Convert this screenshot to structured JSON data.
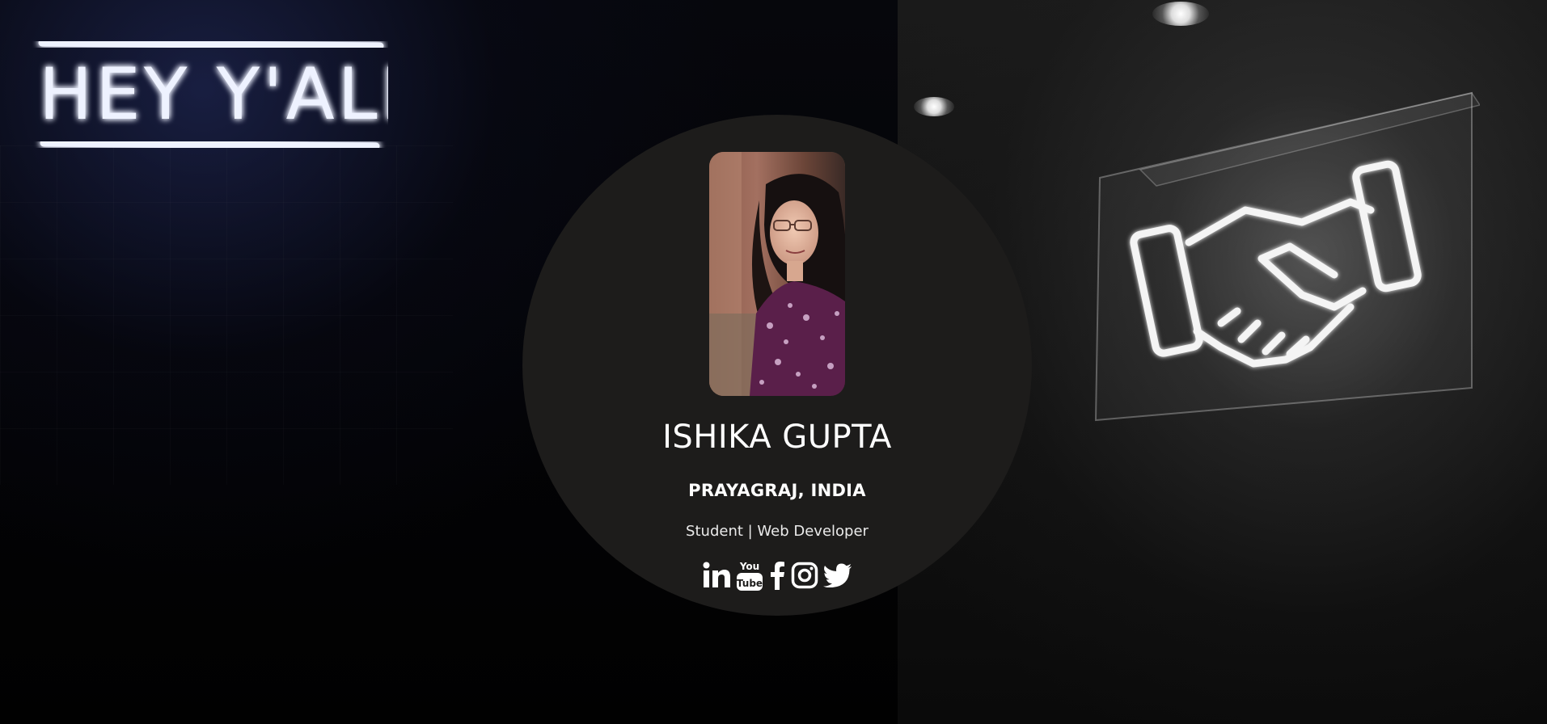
{
  "profile": {
    "name": "ISHIKA GUPTA",
    "location": "PRAYAGRAJ, INDIA",
    "tagline": "Student | Web Developer",
    "photo_alt": "Ishika Gupta"
  },
  "background": {
    "neon_sign_text": "HEY Y'ALL"
  },
  "social": [
    {
      "icon": "linkedin-icon",
      "label": "LinkedIn"
    },
    {
      "icon": "youtube-icon",
      "label": "YouTube"
    },
    {
      "icon": "facebook-icon",
      "label": "Facebook"
    },
    {
      "icon": "instagram-icon",
      "label": "Instagram"
    },
    {
      "icon": "twitter-icon",
      "label": "Twitter"
    }
  ],
  "colors": {
    "circle_bg": "#1d1c1b",
    "text": "#ffffff"
  }
}
